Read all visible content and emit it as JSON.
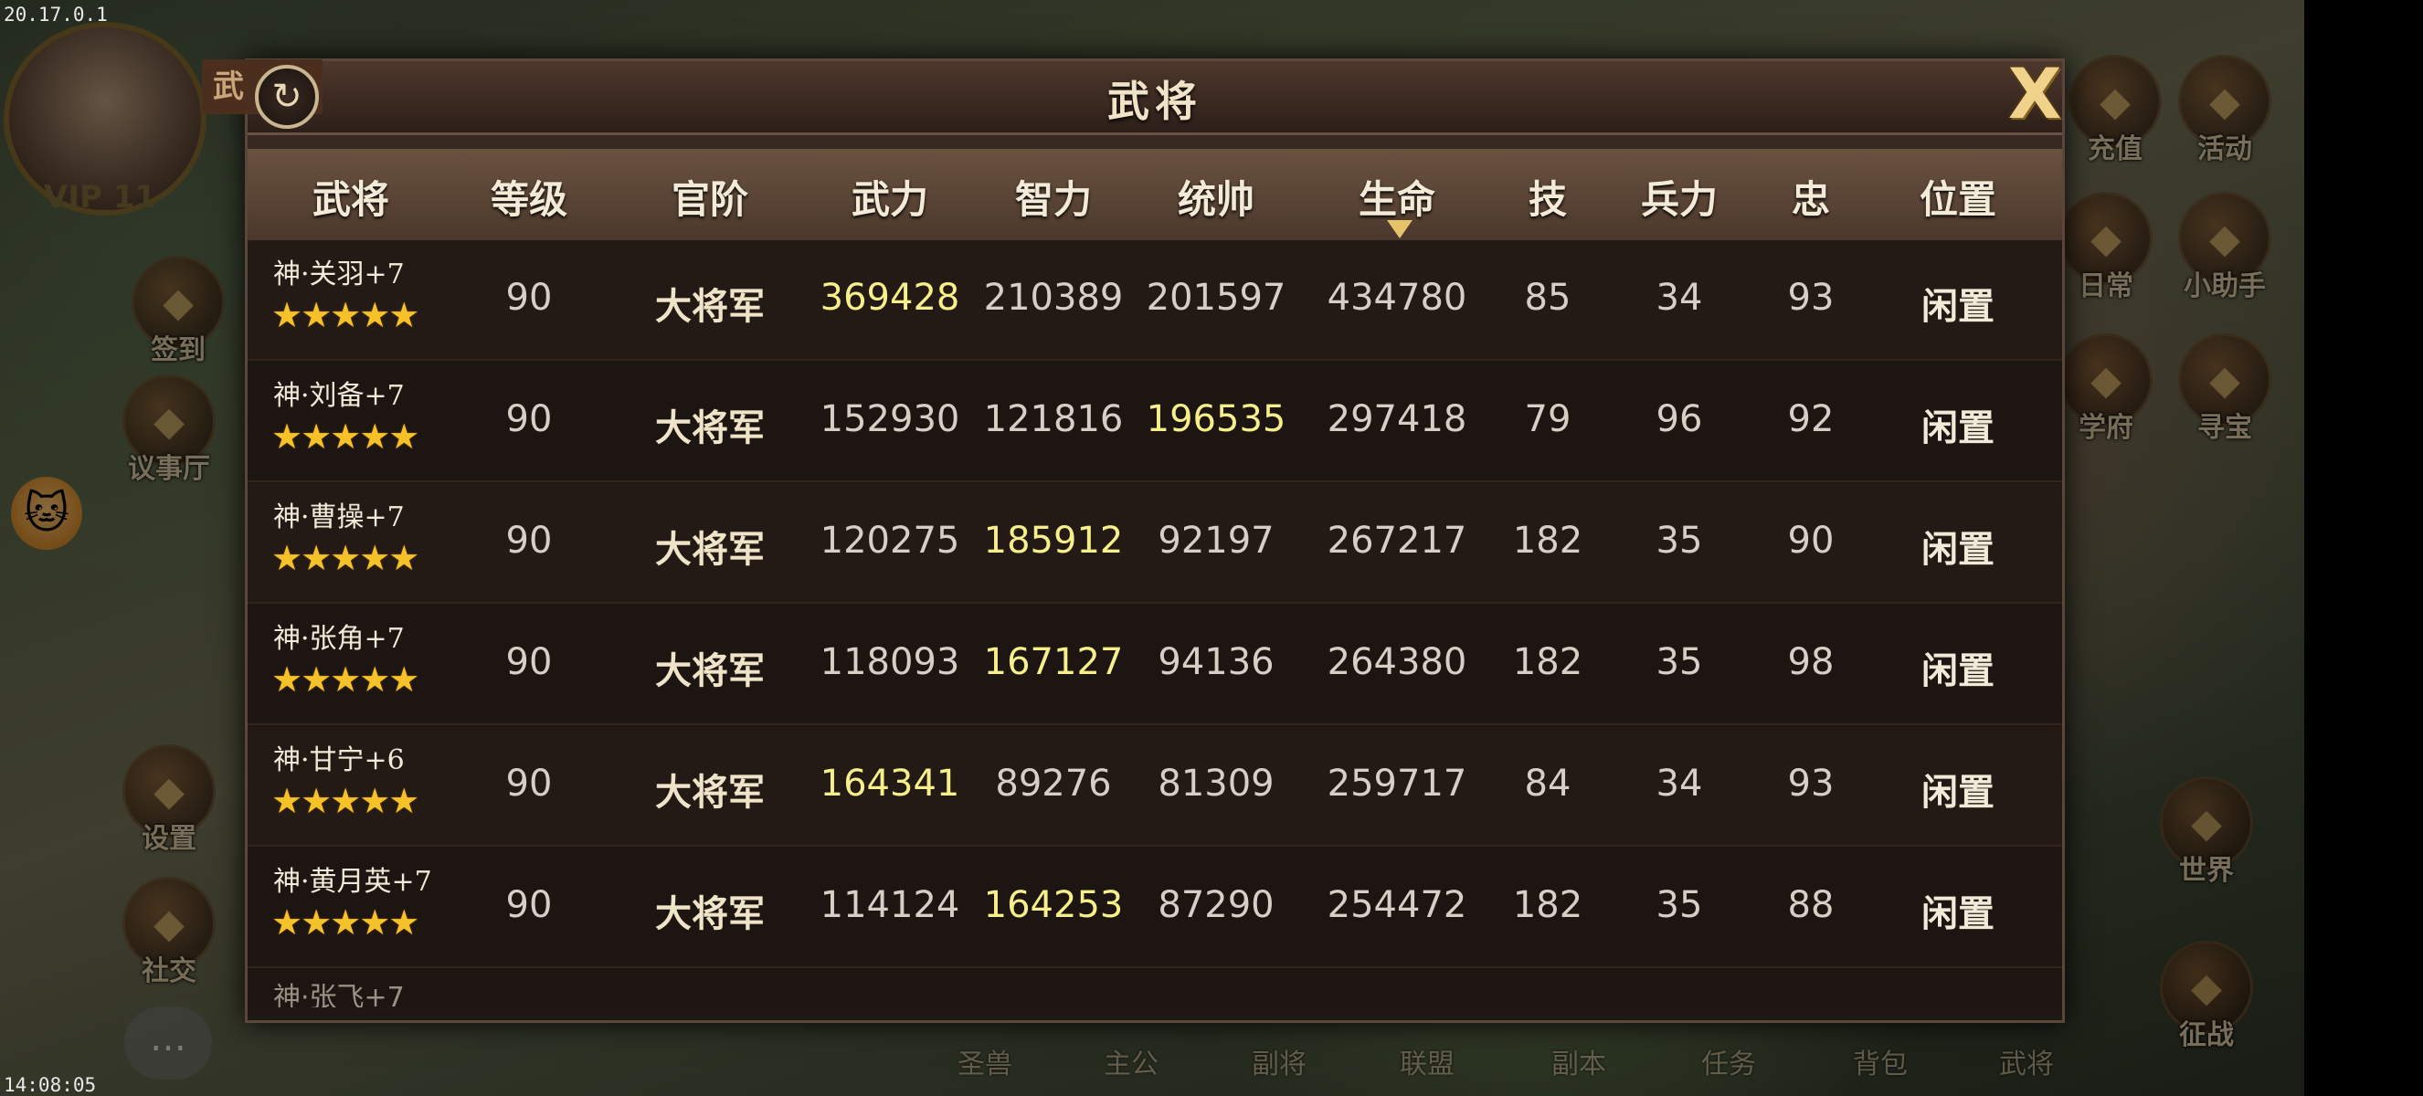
{
  "overlay": {
    "version": "20.17.0.1",
    "clock": "14:08:05"
  },
  "background": {
    "vip_label": "VIP 11",
    "side_left": [
      {
        "label": "签到",
        "icon": "sign-in-icon"
      },
      {
        "label": "议事厅",
        "icon": "council-hall-icon"
      },
      {
        "label": "设置",
        "icon": "gear-icon"
      },
      {
        "label": "社交",
        "icon": "social-icon"
      }
    ],
    "side_right": [
      {
        "label": "充值",
        "icon": "recharge-icon"
      },
      {
        "label": "活动",
        "icon": "gift-icon"
      },
      {
        "label": "日常",
        "icon": "daily-icon"
      },
      {
        "label": "小助手",
        "icon": "helper-icon"
      },
      {
        "label": "学府",
        "icon": "academy-icon"
      },
      {
        "label": "寻宝",
        "icon": "treasure-chest-icon"
      },
      {
        "label": "世界",
        "icon": "world-icon"
      },
      {
        "label": "征战",
        "icon": "campaign-icon"
      }
    ],
    "bottom_nav": [
      "圣兽",
      "主公",
      "副将",
      "联盟",
      "副本",
      "任务",
      "背包",
      "武将"
    ],
    "tab_partial": "武"
  },
  "panel": {
    "title": "武将"
  },
  "table": {
    "headers": [
      "武将",
      "等级",
      "官阶",
      "武力",
      "智力",
      "统帅",
      "生命",
      "技",
      "兵力",
      "忠",
      "位置"
    ],
    "rows": [
      {
        "name": "神·关羽+7",
        "stars": "★★★★★",
        "level": "90",
        "rank": "大将军",
        "force": "369428",
        "intellect": "210389",
        "command": "201597",
        "life": "434780",
        "skill": "85",
        "troops": "34",
        "loyalty": "93",
        "status": "闲置",
        "highlight": "force"
      },
      {
        "name": "神·刘备+7",
        "stars": "★★★★★",
        "level": "90",
        "rank": "大将军",
        "force": "152930",
        "intellect": "121816",
        "command": "196535",
        "life": "297418",
        "skill": "79",
        "troops": "96",
        "loyalty": "92",
        "status": "闲置",
        "highlight": "command"
      },
      {
        "name": "神·曹操+7",
        "stars": "★★★★★",
        "level": "90",
        "rank": "大将军",
        "force": "120275",
        "intellect": "185912",
        "command": "92197",
        "life": "267217",
        "skill": "182",
        "troops": "35",
        "loyalty": "90",
        "status": "闲置",
        "highlight": "intellect"
      },
      {
        "name": "神·张角+7",
        "stars": "★★★★★",
        "level": "90",
        "rank": "大将军",
        "force": "118093",
        "intellect": "167127",
        "command": "94136",
        "life": "264380",
        "skill": "182",
        "troops": "35",
        "loyalty": "98",
        "status": "闲置",
        "highlight": "intellect"
      },
      {
        "name": "神·甘宁+6",
        "stars": "★★★★★",
        "level": "90",
        "rank": "大将军",
        "force": "164341",
        "intellect": "89276",
        "command": "81309",
        "life": "259717",
        "skill": "84",
        "troops": "34",
        "loyalty": "93",
        "status": "闲置",
        "highlight": "force"
      },
      {
        "name": "神·黄月英+7",
        "stars": "★★★★★",
        "level": "90",
        "rank": "大将军",
        "force": "114124",
        "intellect": "164253",
        "command": "87290",
        "life": "254472",
        "skill": "182",
        "troops": "35",
        "loyalty": "88",
        "status": "闲置",
        "highlight": "intellect"
      }
    ],
    "partial_next_row": "神·张飞+7"
  },
  "colors": {
    "highlight": "#f6ef8a",
    "star": "#f5c22a",
    "panel_bg": "#1d1512"
  }
}
